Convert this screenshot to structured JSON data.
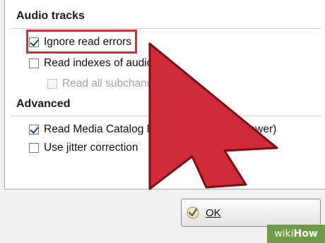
{
  "audio_tracks": {
    "title": "Audio tracks",
    "ignore_read_errors": {
      "label": "Ignore read errors",
      "checked": true
    },
    "read_indexes": {
      "label": "Read indexes of audio",
      "checked": false
    },
    "read_all_subchannels": {
      "label": "Read all subchann",
      "checked": false,
      "disabled": true
    }
  },
  "advanced": {
    "title": "Advanced",
    "read_mcn": {
      "label": "Read Media Catalog Nu",
      "label_tail": "ORC (slower)",
      "checked": true
    },
    "jitter_correction": {
      "label": "Use jitter correction",
      "checked": false
    }
  },
  "ok_button": {
    "label": "OK"
  },
  "watermark": {
    "prefix": "wiki",
    "suffix": "How"
  },
  "colors": {
    "highlight": "#d22e3a",
    "cursor_fill": "#d02a38",
    "cursor_stroke": "#7a0f17",
    "watermark_bg": "#6f9b48"
  }
}
